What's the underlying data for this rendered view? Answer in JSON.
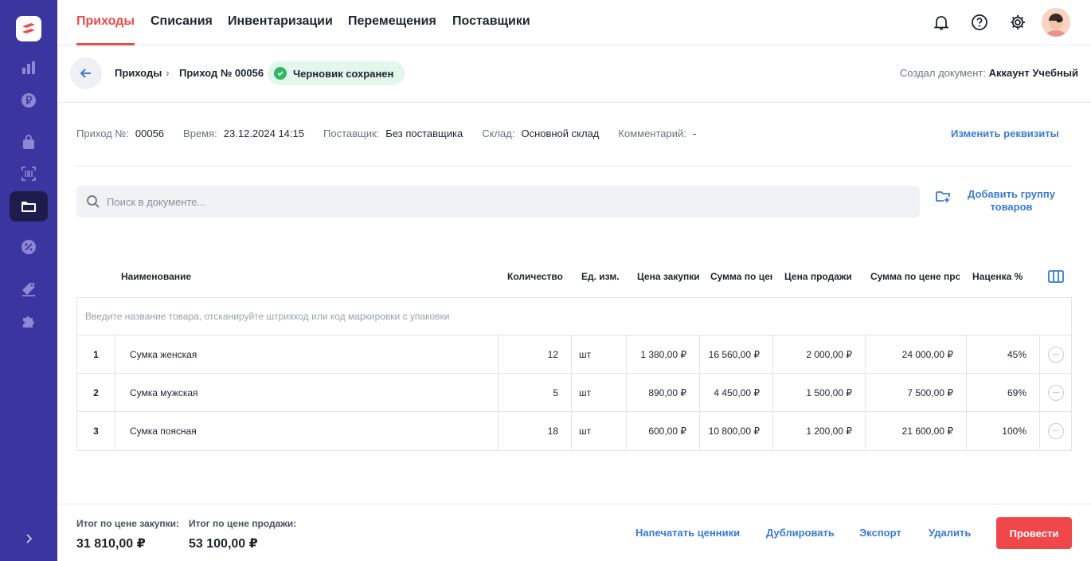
{
  "nav": {
    "tabs": [
      "Приходы",
      "Списания",
      "Инвентаризации",
      "Перемещения",
      "Поставщики"
    ]
  },
  "breadcrumb": {
    "root": "Приходы",
    "current": "Приход № 00056"
  },
  "status": "Черновик сохранен",
  "author": {
    "label": "Создал документ:",
    "name": "Аккаунт Учебный"
  },
  "details": {
    "number": {
      "label": "Приход №:",
      "value": "00056"
    },
    "time": {
      "label": "Время:",
      "value": "23.12.2024 14:15"
    },
    "supplier": {
      "label": "Поставщик:",
      "value": "Без поставщика"
    },
    "warehouse": {
      "label": "Склад:",
      "value": "Основной склад"
    },
    "comment": {
      "label": "Комментарий:",
      "value": "-"
    }
  },
  "edit_link": "Изменить реквизиты",
  "search": {
    "placeholder": "Поиск в документе..."
  },
  "add_group": {
    "line1": "Добавить группу",
    "line2": "товаров"
  },
  "table": {
    "headers": {
      "name": "Наименование",
      "qty": "Количество",
      "unit": "Ед. изм.",
      "buy_price": "Цена закупки",
      "buy_sum": "Сумма по цене закупки",
      "sell_price": "Цена продажи",
      "sell_sum": "Сумма по цене продажи",
      "markup": "Наценка %"
    },
    "entry_placeholder": "Введите название товара, отсканируйте штрихкод или код маркировки с упаковки",
    "rows": [
      {
        "num": "1",
        "name": "Сумка женская",
        "qty": "12",
        "unit": "шт",
        "buy_price": "1 380,00 ₽",
        "buy_sum": "16 560,00 ₽",
        "sell_price": "2 000,00 ₽",
        "sell_sum": "24 000,00 ₽",
        "markup": "45%"
      },
      {
        "num": "2",
        "name": "Сумка мужская",
        "qty": "5",
        "unit": "шт",
        "buy_price": "890,00 ₽",
        "buy_sum": "4 450,00 ₽",
        "sell_price": "1 500,00 ₽",
        "sell_sum": "7 500,00 ₽",
        "markup": "69%"
      },
      {
        "num": "3",
        "name": "Сумка поясная",
        "qty": "18",
        "unit": "шт",
        "buy_price": "600,00 ₽",
        "buy_sum": "10 800,00 ₽",
        "sell_price": "1 200,00 ₽",
        "sell_sum": "21 600,00 ₽",
        "markup": "100%"
      }
    ]
  },
  "footer": {
    "total_buy": {
      "label": "Итог по цене закупки:",
      "value": "31 810,00 ₽"
    },
    "total_sell": {
      "label": "Итог по цене продажи:",
      "value": "53 100,00 ₽"
    },
    "actions": {
      "print": "Напечатать ценники",
      "duplicate": "Дублировать",
      "export": "Экспорт",
      "delete": "Удалить",
      "submit": "Провести"
    }
  },
  "colors": {
    "sidebar": "#3b35a0",
    "accent": "#ef4a4a",
    "link": "#3a7ad8",
    "success": "#2eb865"
  },
  "icons": [
    "logo",
    "chart-icon",
    "ruble-icon",
    "bag-icon",
    "barcode-icon",
    "folder-icon",
    "percent-icon",
    "tag-icon",
    "puzzle-icon",
    "chevron-right-icon",
    "bell-icon",
    "help-icon",
    "gear-icon",
    "avatar",
    "arrow-left-icon",
    "check-icon",
    "search-icon",
    "folder-plus-icon",
    "columns-icon",
    "remove-icon"
  ]
}
